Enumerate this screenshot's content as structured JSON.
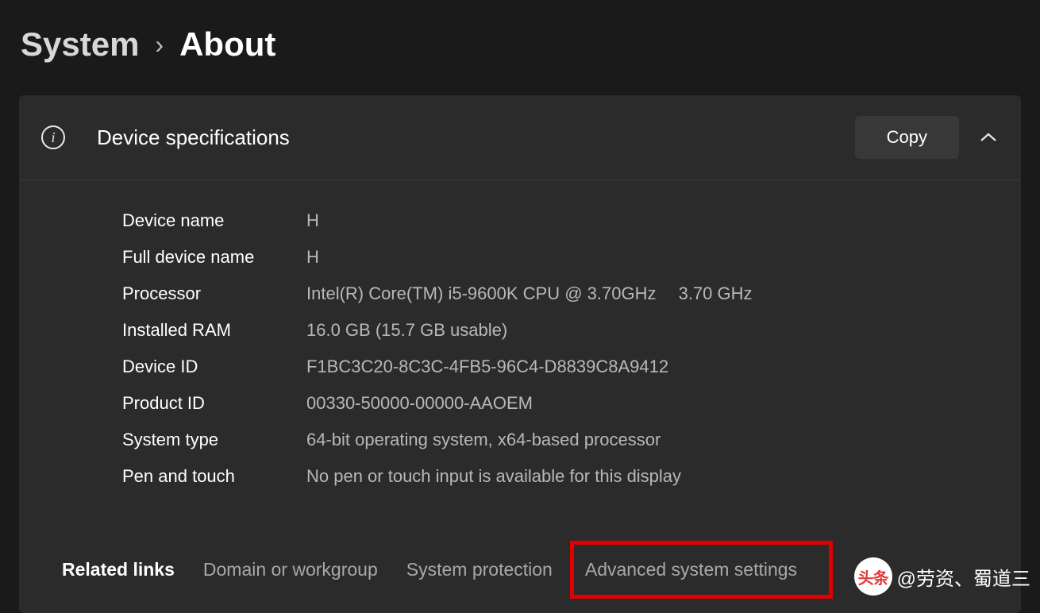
{
  "breadcrumb": {
    "parent": "System",
    "current": "About"
  },
  "card": {
    "title": "Device specifications",
    "copy_label": "Copy"
  },
  "specs": {
    "device_name": {
      "label": "Device name",
      "value": "H"
    },
    "full_device_name": {
      "label": "Full device name",
      "value": "H"
    },
    "processor": {
      "label": "Processor",
      "value": "Intel(R) Core(TM) i5-9600K CPU @ 3.70GHz",
      "extra": "3.70 GHz"
    },
    "installed_ram": {
      "label": "Installed RAM",
      "value": "16.0 GB (15.7 GB usable)"
    },
    "device_id": {
      "label": "Device ID",
      "value": "F1BC3C20-8C3C-4FB5-96C4-D8839C8A9412"
    },
    "product_id": {
      "label": "Product ID",
      "value": "00330-50000-00000-AAOEM"
    },
    "system_type": {
      "label": "System type",
      "value": "64-bit operating system, x64-based processor"
    },
    "pen_touch": {
      "label": "Pen and touch",
      "value": "No pen or touch input is available for this display"
    }
  },
  "related": {
    "label": "Related links",
    "domain": "Domain or workgroup",
    "protection": "System protection",
    "advanced": "Advanced system settings"
  },
  "watermark": {
    "badge": "头条",
    "text": "@劳资、蜀道三"
  }
}
